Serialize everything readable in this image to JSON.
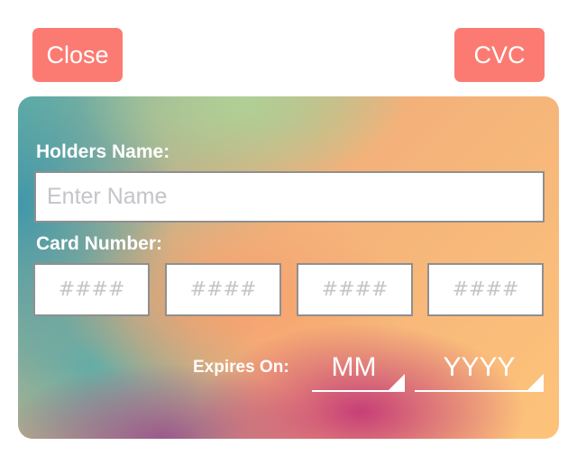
{
  "header": {
    "close_label": "Close",
    "cvc_label": "CVC"
  },
  "card": {
    "holder_label": "Holders Name:",
    "holder_placeholder": "Enter Name",
    "holder_value": "",
    "number_label": "Card Number:",
    "number_groups": [
      {
        "placeholder": "####",
        "value": ""
      },
      {
        "placeholder": "####",
        "value": ""
      },
      {
        "placeholder": "####",
        "value": ""
      },
      {
        "placeholder": "####",
        "value": ""
      }
    ],
    "expires_label": "Expires On:",
    "month_value": "MM",
    "year_value": "YYYY"
  },
  "colors": {
    "button": "#fb7b73",
    "button_text": "#ffffff",
    "field_border": "#8f8f8f",
    "placeholder": "#c4c4c9"
  },
  "icons": {
    "dropdown": "dropdown-triangle-icon"
  }
}
